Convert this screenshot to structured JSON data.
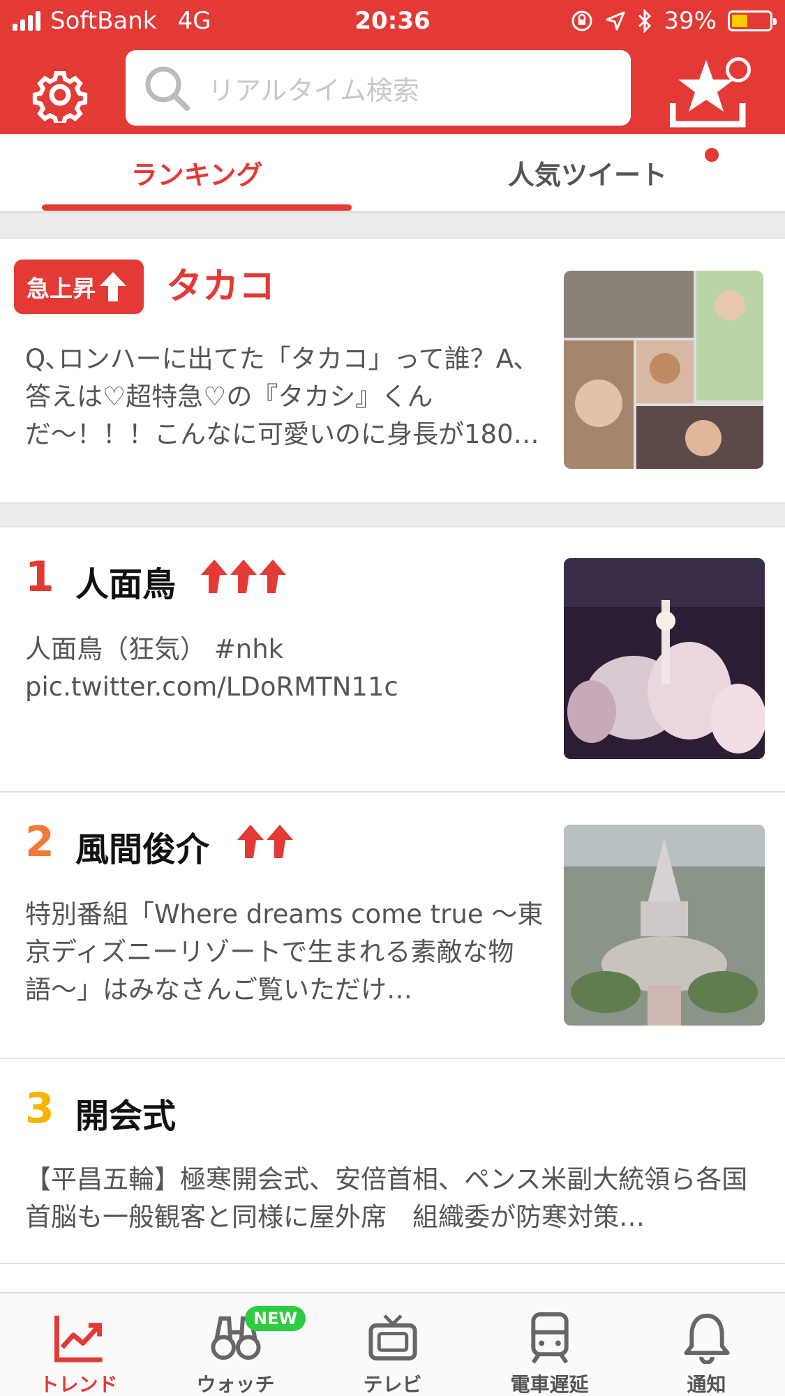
{
  "status_bar": {
    "carrier": "SoftBank",
    "network": "4G",
    "time": "20:36",
    "battery": "39%"
  },
  "header": {
    "search_placeholder": "リアルタイム検索"
  },
  "tabs": [
    {
      "label": "ランキング",
      "active": true
    },
    {
      "label": "人気ツイート",
      "active": false
    }
  ],
  "surge": {
    "badge": "急上昇",
    "title": "タカコ",
    "description": "Q､ロンハーに出てた「タカコ」って誰？A､答えは♡超特急♡の『タカシ』くんだ〜！！！こんなに可愛いのに身長が180…"
  },
  "ranking": [
    {
      "rank": "1",
      "title": "人面鳥",
      "description": "人面鳥（狂気） #nhk pic.twitter.com/LDoRMTN11c",
      "rank_color": "#e33a36",
      "trend_arrows": 3
    },
    {
      "rank": "2",
      "title": "風間俊介",
      "description": "特別番組「Where dreams come true 〜東京ディズニーリゾートで生まれる素敵な物語〜」はみなさんご覧いただけ…",
      "rank_color": "#f07a35",
      "trend_arrows": 2
    },
    {
      "rank": "3",
      "title": "開会式",
      "description": "【平昌五輪】極寒開会式、安倍首相、ペンス米副大統領ら各国首脳も一般観客と同様に屋外席　組織委が防寒対策…",
      "rank_color": "#f4b400",
      "trend_arrows": 0
    }
  ],
  "bottom_nav": [
    {
      "label": "トレンド",
      "icon": "trend-chart-icon",
      "active": true
    },
    {
      "label": "ウォッチ",
      "icon": "binoculars-icon",
      "badge": "NEW"
    },
    {
      "label": "テレビ",
      "icon": "tv-icon"
    },
    {
      "label": "電車遅延",
      "icon": "train-icon"
    },
    {
      "label": "通知",
      "icon": "bell-icon"
    }
  ],
  "colors": {
    "brand_red": "#e33a36",
    "new_badge_green": "#2ecc40"
  }
}
